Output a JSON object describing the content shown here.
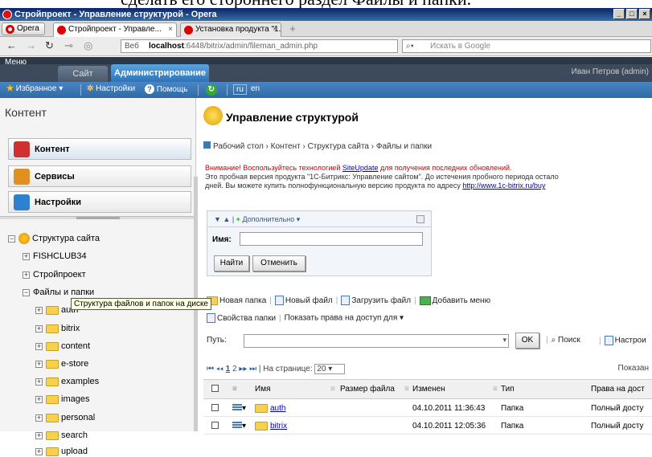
{
  "doc_fragment": "сделать его стороннего раздел Файлы и папки.",
  "window": {
    "title": "Стройпроект - Управление структурой - Opera",
    "buttons": [
      "_",
      "□",
      "×"
    ]
  },
  "browser": {
    "opera_button": "Opera",
    "tabs": [
      {
        "label": "Стройпроект - Управле...",
        "active": true
      },
      {
        "label": "Установка продукта \"1...",
        "active": false
      }
    ],
    "web_label": "Веб",
    "address_host": "localhost",
    "address_rest": ":6448/bitrix/admin/fileman_admin.php",
    "search_placeholder": "Искать в Google"
  },
  "admin": {
    "menu_label": "Меню",
    "site_tab": "Сайт",
    "admin_tab": "Администрирование",
    "user": "Иван Петров (admin)",
    "favorites": "Избранное",
    "settings": "Настройки",
    "help": "Помощь",
    "lang_ru": "ru",
    "lang_en": "en"
  },
  "sidebar": {
    "heading": "Контент",
    "buttons": [
      {
        "label": "Контент",
        "color": "#d03030"
      },
      {
        "label": "Сервисы",
        "color": "#e09020"
      },
      {
        "label": "Настройки",
        "color": "#3080d0"
      }
    ],
    "tree_root": "Структура сайта",
    "tree": [
      {
        "label": "FISHCLUB34",
        "level": 1,
        "folder": false
      },
      {
        "label": "Стройпроект",
        "level": 1,
        "folder": false
      },
      {
        "label": "Файлы и папки",
        "level": 1,
        "folder": false,
        "expanded": true
      },
      {
        "label": "auth",
        "level": 2,
        "folder": true
      },
      {
        "label": "bitrix",
        "level": 2,
        "folder": true
      },
      {
        "label": "content",
        "level": 2,
        "folder": true
      },
      {
        "label": "e-store",
        "level": 2,
        "folder": true
      },
      {
        "label": "examples",
        "level": 2,
        "folder": true
      },
      {
        "label": "images",
        "level": 2,
        "folder": true
      },
      {
        "label": "personal",
        "level": 2,
        "folder": true
      },
      {
        "label": "search",
        "level": 2,
        "folder": true
      },
      {
        "label": "upload",
        "level": 2,
        "folder": true
      }
    ],
    "tooltip": "Структура файлов и папок на диске"
  },
  "main": {
    "title": "Управление структурой",
    "breadcrumb": "Рабочий стол › Контент › Структура сайта › Файлы и папки",
    "warning_bold": "Внимание! Воспользуйтесь технологией",
    "warning_link": "SiteUpdate",
    "warning_rest": "для получения последних обновлений.",
    "warning_line2": "Это пробная версия продукта \"1С-Битрикс: Управление сайтом\". До истечения пробного периода остало",
    "warning_line3": "дней. Вы можете купить полнофункциональную версию продукта по адресу",
    "warning_url": "http://www.1c-bitrix.ru/buy",
    "filter": {
      "more": "Дополнительно",
      "name_label": "Имя:",
      "find": "Найти",
      "cancel": "Отменить"
    },
    "toolbar": {
      "new_folder": "Новая папка",
      "new_file": "Новый файл",
      "upload": "Загрузить файл",
      "add_menu": "Добавить меню",
      "folder_props": "Свойства папки",
      "show_rights": "Показать права на доступ для",
      "path_label": "Путь:",
      "ok": "OK",
      "search": "Поиск",
      "settings": "Настрои"
    },
    "pager": {
      "pages": [
        "1",
        "2"
      ],
      "per_page_label": "На странице:",
      "per_page": "20",
      "shown": "Показан"
    },
    "table": {
      "columns": [
        "Имя",
        "Размер файла",
        "Изменен",
        "Тип",
        "Права на дост"
      ],
      "rows": [
        {
          "name": "auth",
          "size": "",
          "modified": "04.10.2011 11:36:43",
          "type": "Папка",
          "rights": "Полный досту"
        },
        {
          "name": "bitrix",
          "size": "",
          "modified": "04.10.2011 12:05:36",
          "type": "Папка",
          "rights": "Полный досту"
        }
      ]
    }
  }
}
